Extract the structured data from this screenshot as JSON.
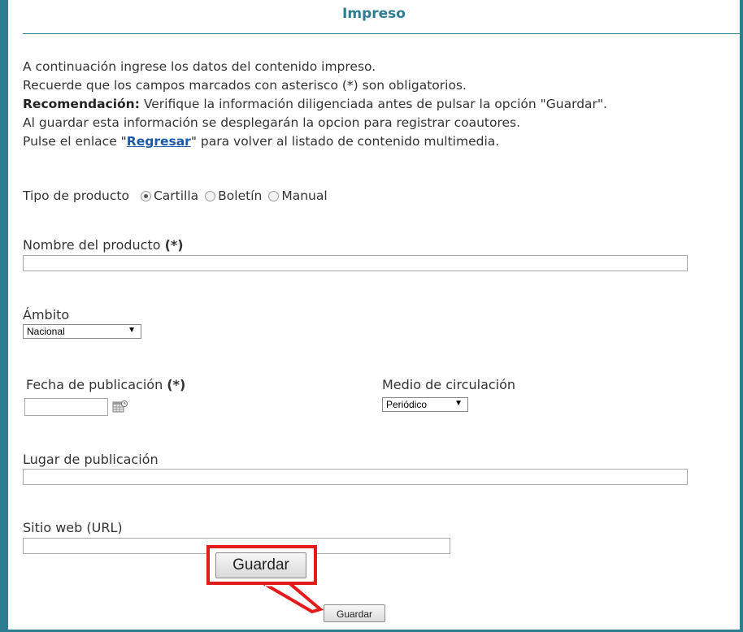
{
  "header": {
    "title": "Impreso"
  },
  "intro": {
    "line1": "A continuación ingrese los datos del contenido impreso.",
    "line2": "Recuerde que los campos marcados con asterisco (*) son obligatorios.",
    "line3_bold": "Recomendación:",
    "line3_rest": " Verifique la información diligenciada antes de pulsar la opción \"Guardar\".",
    "line4": "Al guardar esta información se desplegarán la opcion para registrar coautores.",
    "line5_pre": "Pulse el enlace \"",
    "line5_link": "Regresar",
    "line5_post": "\" para volver al listado de contenido multimedia."
  },
  "tipo": {
    "label": "Tipo de producto",
    "options": [
      "Cartilla",
      "Boletín",
      "Manual"
    ],
    "selected": "Cartilla"
  },
  "fields": {
    "nombre_label": "Nombre del producto",
    "required_mark": "(*)",
    "nombre_value": "",
    "ambito_label": "Ámbito",
    "ambito_value": "Nacional",
    "fecha_label": "Fecha de publicación",
    "fecha_value": "",
    "medio_label": "Medio de circulación",
    "medio_value": "Periódico",
    "lugar_label": "Lugar de publicación",
    "lugar_value": "",
    "sitio_label": "Sitio web (URL)",
    "sitio_value": ""
  },
  "buttons": {
    "guardar_zoom": "Guardar",
    "guardar": "Guardar"
  },
  "icons": {
    "calendar": "calendar-icon",
    "caret": "▼"
  },
  "colors": {
    "accent": "#2b7d8f",
    "highlight": "#e31b1b",
    "link": "#1a5aa8"
  }
}
